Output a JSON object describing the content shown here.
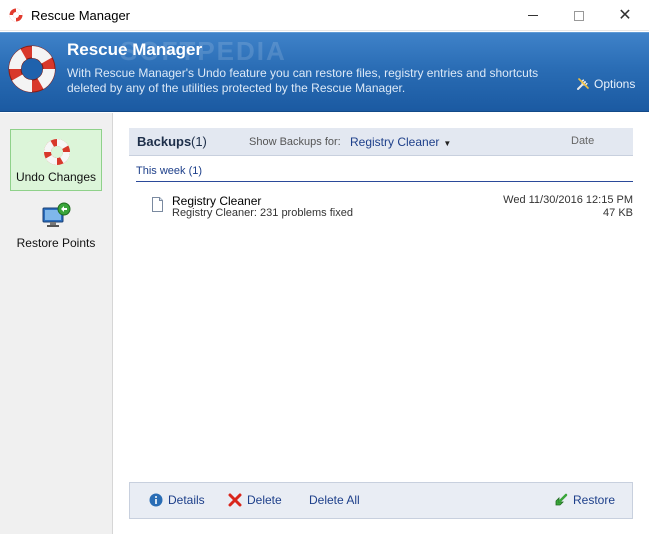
{
  "window": {
    "title": "Rescue Manager"
  },
  "banner": {
    "title": "Rescue Manager",
    "watermark": "SOFTPEDIA",
    "description": "With Rescue Manager's Undo feature you can restore files, registry entries and shortcuts deleted by any of the utilities protected by the Rescue Manager.",
    "options_label": "Options"
  },
  "sidebar": {
    "items": [
      {
        "label": "Undo Changes",
        "icon": "lifebuoy-icon",
        "active": true
      },
      {
        "label": "Restore Points",
        "icon": "computer-restore-icon",
        "active": false
      }
    ]
  },
  "backups": {
    "title": "Backups",
    "count": "(1)",
    "show_label": "Show Backups for:",
    "filter_value": "Registry Cleaner",
    "date_header": "Date",
    "group_label": "This week (1)",
    "rows": [
      {
        "name": "Registry Cleaner",
        "description": "Registry Cleaner: 231 problems fixed",
        "date": "Wed 11/30/2016 12:15 PM",
        "size": "47 KB"
      }
    ]
  },
  "toolbar": {
    "details_label": "Details",
    "delete_label": "Delete",
    "delete_all_label": "Delete All",
    "restore_label": "Restore"
  },
  "colors": {
    "banner": "#2a6db5",
    "link": "#1d3f8a",
    "active_sidebar": "#dcf5d9",
    "delete_red": "#d9261c",
    "restore_green": "#3aa53a"
  }
}
